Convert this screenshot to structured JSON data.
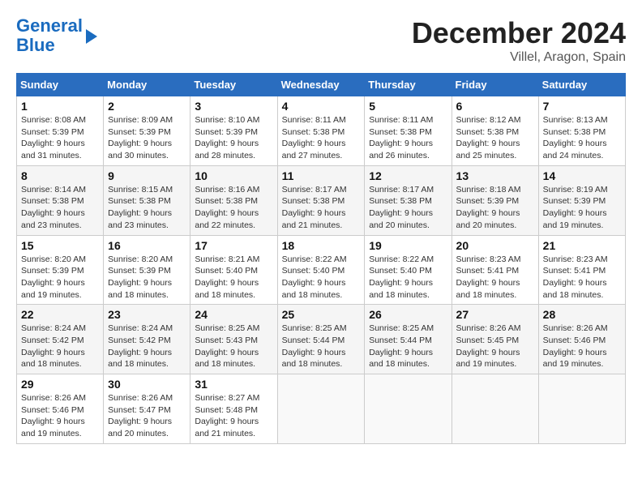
{
  "logo": {
    "line1": "General",
    "line2": "Blue"
  },
  "title": "December 2024",
  "subtitle": "Villel, Aragon, Spain",
  "weekdays": [
    "Sunday",
    "Monday",
    "Tuesday",
    "Wednesday",
    "Thursday",
    "Friday",
    "Saturday"
  ],
  "weeks": [
    [
      {
        "day": "1",
        "info": "Sunrise: 8:08 AM\nSunset: 5:39 PM\nDaylight: 9 hours\nand 31 minutes."
      },
      {
        "day": "2",
        "info": "Sunrise: 8:09 AM\nSunset: 5:39 PM\nDaylight: 9 hours\nand 30 minutes."
      },
      {
        "day": "3",
        "info": "Sunrise: 8:10 AM\nSunset: 5:39 PM\nDaylight: 9 hours\nand 28 minutes."
      },
      {
        "day": "4",
        "info": "Sunrise: 8:11 AM\nSunset: 5:38 PM\nDaylight: 9 hours\nand 27 minutes."
      },
      {
        "day": "5",
        "info": "Sunrise: 8:11 AM\nSunset: 5:38 PM\nDaylight: 9 hours\nand 26 minutes."
      },
      {
        "day": "6",
        "info": "Sunrise: 8:12 AM\nSunset: 5:38 PM\nDaylight: 9 hours\nand 25 minutes."
      },
      {
        "day": "7",
        "info": "Sunrise: 8:13 AM\nSunset: 5:38 PM\nDaylight: 9 hours\nand 24 minutes."
      }
    ],
    [
      {
        "day": "8",
        "info": "Sunrise: 8:14 AM\nSunset: 5:38 PM\nDaylight: 9 hours\nand 23 minutes."
      },
      {
        "day": "9",
        "info": "Sunrise: 8:15 AM\nSunset: 5:38 PM\nDaylight: 9 hours\nand 23 minutes."
      },
      {
        "day": "10",
        "info": "Sunrise: 8:16 AM\nSunset: 5:38 PM\nDaylight: 9 hours\nand 22 minutes."
      },
      {
        "day": "11",
        "info": "Sunrise: 8:17 AM\nSunset: 5:38 PM\nDaylight: 9 hours\nand 21 minutes."
      },
      {
        "day": "12",
        "info": "Sunrise: 8:17 AM\nSunset: 5:38 PM\nDaylight: 9 hours\nand 20 minutes."
      },
      {
        "day": "13",
        "info": "Sunrise: 8:18 AM\nSunset: 5:39 PM\nDaylight: 9 hours\nand 20 minutes."
      },
      {
        "day": "14",
        "info": "Sunrise: 8:19 AM\nSunset: 5:39 PM\nDaylight: 9 hours\nand 19 minutes."
      }
    ],
    [
      {
        "day": "15",
        "info": "Sunrise: 8:20 AM\nSunset: 5:39 PM\nDaylight: 9 hours\nand 19 minutes."
      },
      {
        "day": "16",
        "info": "Sunrise: 8:20 AM\nSunset: 5:39 PM\nDaylight: 9 hours\nand 18 minutes."
      },
      {
        "day": "17",
        "info": "Sunrise: 8:21 AM\nSunset: 5:40 PM\nDaylight: 9 hours\nand 18 minutes."
      },
      {
        "day": "18",
        "info": "Sunrise: 8:22 AM\nSunset: 5:40 PM\nDaylight: 9 hours\nand 18 minutes."
      },
      {
        "day": "19",
        "info": "Sunrise: 8:22 AM\nSunset: 5:40 PM\nDaylight: 9 hours\nand 18 minutes."
      },
      {
        "day": "20",
        "info": "Sunrise: 8:23 AM\nSunset: 5:41 PM\nDaylight: 9 hours\nand 18 minutes."
      },
      {
        "day": "21",
        "info": "Sunrise: 8:23 AM\nSunset: 5:41 PM\nDaylight: 9 hours\nand 18 minutes."
      }
    ],
    [
      {
        "day": "22",
        "info": "Sunrise: 8:24 AM\nSunset: 5:42 PM\nDaylight: 9 hours\nand 18 minutes."
      },
      {
        "day": "23",
        "info": "Sunrise: 8:24 AM\nSunset: 5:42 PM\nDaylight: 9 hours\nand 18 minutes."
      },
      {
        "day": "24",
        "info": "Sunrise: 8:25 AM\nSunset: 5:43 PM\nDaylight: 9 hours\nand 18 minutes."
      },
      {
        "day": "25",
        "info": "Sunrise: 8:25 AM\nSunset: 5:44 PM\nDaylight: 9 hours\nand 18 minutes."
      },
      {
        "day": "26",
        "info": "Sunrise: 8:25 AM\nSunset: 5:44 PM\nDaylight: 9 hours\nand 18 minutes."
      },
      {
        "day": "27",
        "info": "Sunrise: 8:26 AM\nSunset: 5:45 PM\nDaylight: 9 hours\nand 19 minutes."
      },
      {
        "day": "28",
        "info": "Sunrise: 8:26 AM\nSunset: 5:46 PM\nDaylight: 9 hours\nand 19 minutes."
      }
    ],
    [
      {
        "day": "29",
        "info": "Sunrise: 8:26 AM\nSunset: 5:46 PM\nDaylight: 9 hours\nand 19 minutes."
      },
      {
        "day": "30",
        "info": "Sunrise: 8:26 AM\nSunset: 5:47 PM\nDaylight: 9 hours\nand 20 minutes."
      },
      {
        "day": "31",
        "info": "Sunrise: 8:27 AM\nSunset: 5:48 PM\nDaylight: 9 hours\nand 21 minutes."
      },
      null,
      null,
      null,
      null
    ]
  ]
}
